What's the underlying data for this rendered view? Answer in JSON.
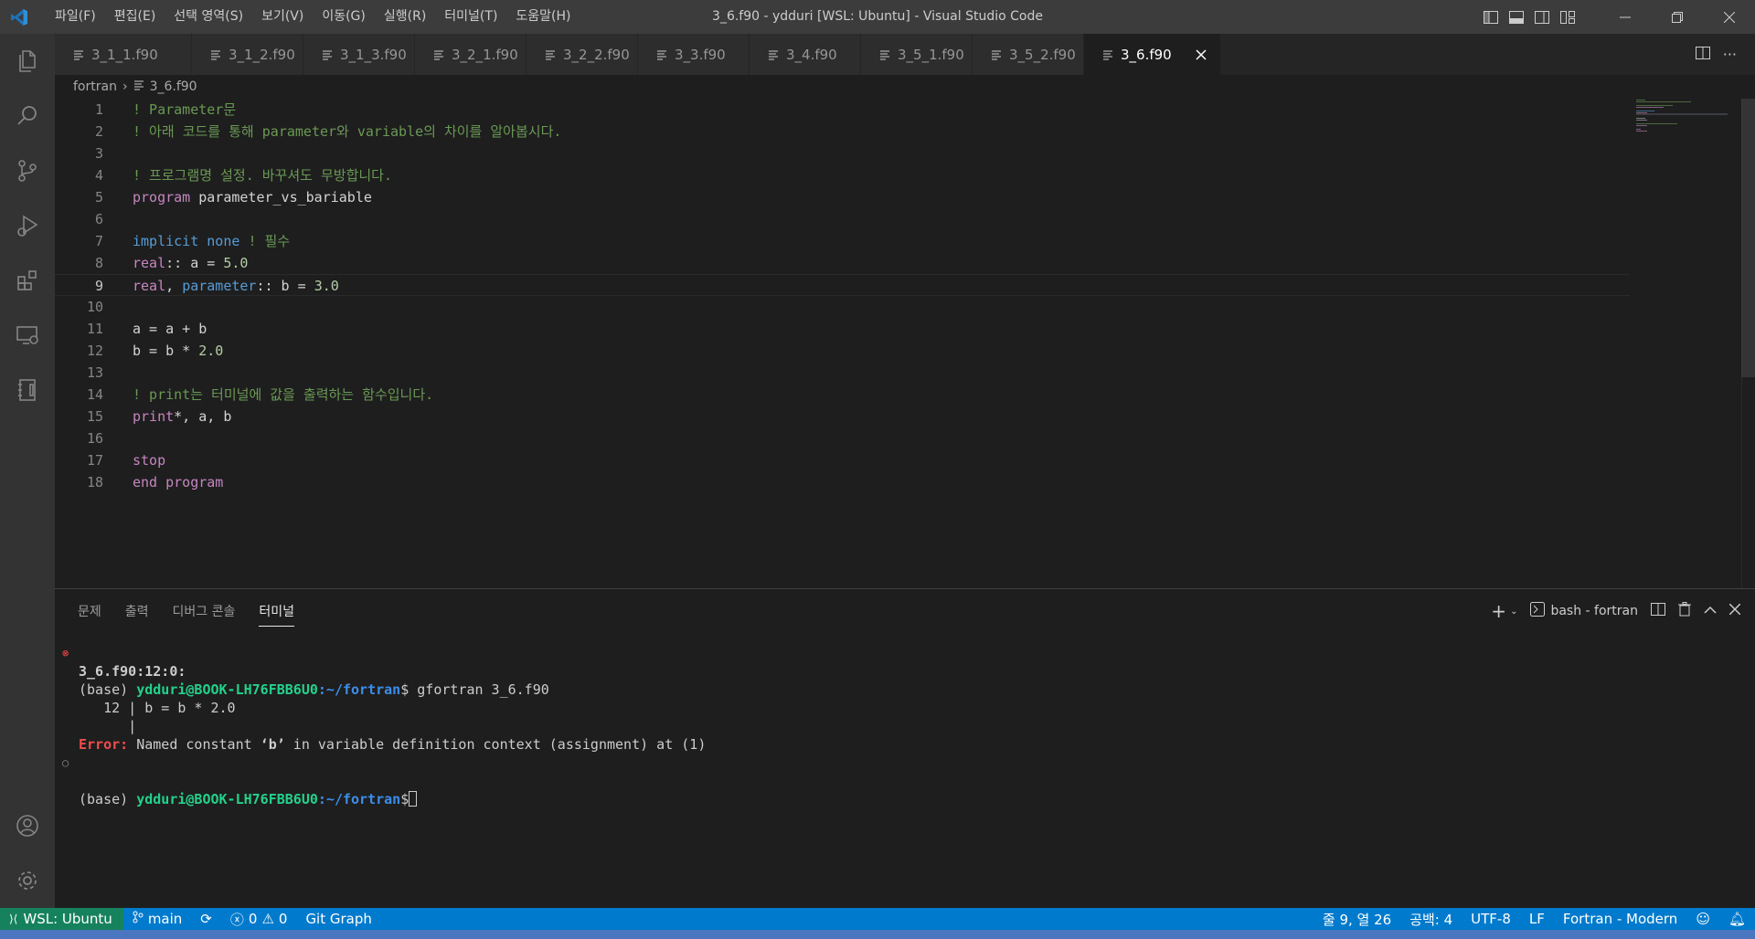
{
  "window": {
    "title": "3_6.f90 - ydduri [WSL: Ubuntu] - Visual Studio Code",
    "menu": [
      "파일(F)",
      "편집(E)",
      "선택 영역(S)",
      "보기(V)",
      "이동(G)",
      "실행(R)",
      "터미널(T)",
      "도움말(H)"
    ]
  },
  "tabs": [
    {
      "label": "3_1_1.f90",
      "active": false
    },
    {
      "label": "3_1_2.f90",
      "active": false
    },
    {
      "label": "3_1_3.f90",
      "active": false
    },
    {
      "label": "3_2_1.f90",
      "active": false
    },
    {
      "label": "3_2_2.f90",
      "active": false
    },
    {
      "label": "3_3.f90",
      "active": false
    },
    {
      "label": "3_4.f90",
      "active": false
    },
    {
      "label": "3_5_1.f90",
      "active": false
    },
    {
      "label": "3_5_2.f90",
      "active": false
    },
    {
      "label": "3_6.f90",
      "active": true
    }
  ],
  "breadcrumb": {
    "folder": "fortran",
    "file": "3_6.f90"
  },
  "editor": {
    "current_line": 9,
    "lines": [
      {
        "n": "1",
        "t": [
          [
            "cm",
            "! Parameter문"
          ]
        ]
      },
      {
        "n": "2",
        "t": [
          [
            "cm",
            "! 아래 코드를 통해 parameter와 variable의 차이를 알아봅시다."
          ]
        ]
      },
      {
        "n": "3",
        "t": []
      },
      {
        "n": "4",
        "t": [
          [
            "cm",
            "! 프로그램명 설정. 바꾸셔도 무방합니다."
          ]
        ]
      },
      {
        "n": "5",
        "t": [
          [
            "kw",
            "program"
          ],
          [
            "",
            " parameter_vs_bariable"
          ]
        ]
      },
      {
        "n": "6",
        "t": []
      },
      {
        "n": "7",
        "t": [
          [
            "kb",
            "implicit none"
          ],
          [
            "",
            " "
          ],
          [
            "cm",
            "! 필수"
          ]
        ]
      },
      {
        "n": "8",
        "t": [
          [
            "kw",
            "real"
          ],
          [
            "",
            ":: a = "
          ],
          [
            "nm",
            "5.0"
          ]
        ]
      },
      {
        "n": "9",
        "t": [
          [
            "kw",
            "real"
          ],
          [
            "",
            ", "
          ],
          [
            "kb",
            "parameter"
          ],
          [
            "",
            ":: b = "
          ],
          [
            "nm",
            "3.0"
          ]
        ]
      },
      {
        "n": "10",
        "t": []
      },
      {
        "n": "11",
        "t": [
          [
            "",
            "a = a + b"
          ]
        ]
      },
      {
        "n": "12",
        "t": [
          [
            "",
            "b = b * "
          ],
          [
            "nm",
            "2.0"
          ]
        ]
      },
      {
        "n": "13",
        "t": []
      },
      {
        "n": "14",
        "t": [
          [
            "cm",
            "! print는 터미널에 값을 출력하는 함수입니다."
          ]
        ]
      },
      {
        "n": "15",
        "t": [
          [
            "kw",
            "print"
          ],
          [
            "",
            "*, a, b"
          ]
        ]
      },
      {
        "n": "16",
        "t": []
      },
      {
        "n": "17",
        "t": [
          [
            "kw",
            "stop"
          ]
        ]
      },
      {
        "n": "18",
        "t": [
          [
            "kw",
            "end program"
          ]
        ]
      }
    ]
  },
  "panel": {
    "tabs": [
      "문제",
      "출력",
      "디버그 콘솔",
      "터미널"
    ],
    "active_tab": "터미널",
    "terminal_name": "bash - fortran",
    "prompt_env": "(base)",
    "prompt_user": "ydduri@BOOK-LH76FBB6U0",
    "prompt_path": ":~/fortran",
    "prompt_sign": "$",
    "command": " gfortran 3_6.f90",
    "error_location": "3_6.f90:12:0:",
    "source_line_no": "12",
    "source_line": "b = b * 2.0",
    "error_label": "Error:",
    "error_msg_pre": " Named constant ",
    "error_constant": "‘b’",
    "error_msg_post": " in variable definition context (assignment) at (1)"
  },
  "status": {
    "remote": "WSL: Ubuntu",
    "branch": "main",
    "errors": "0",
    "warnings": "0",
    "git_graph": "Git Graph",
    "position": "줄 9, 열 26",
    "spaces": "공백: 4",
    "encoding": "UTF-8",
    "eol": "LF",
    "language": "Fortran - Modern"
  },
  "colors": {
    "accent": "#007acc",
    "remote": "#16825d",
    "comment": "#6a9955",
    "keyword": "#c586c0",
    "builtin": "#569cd6"
  }
}
